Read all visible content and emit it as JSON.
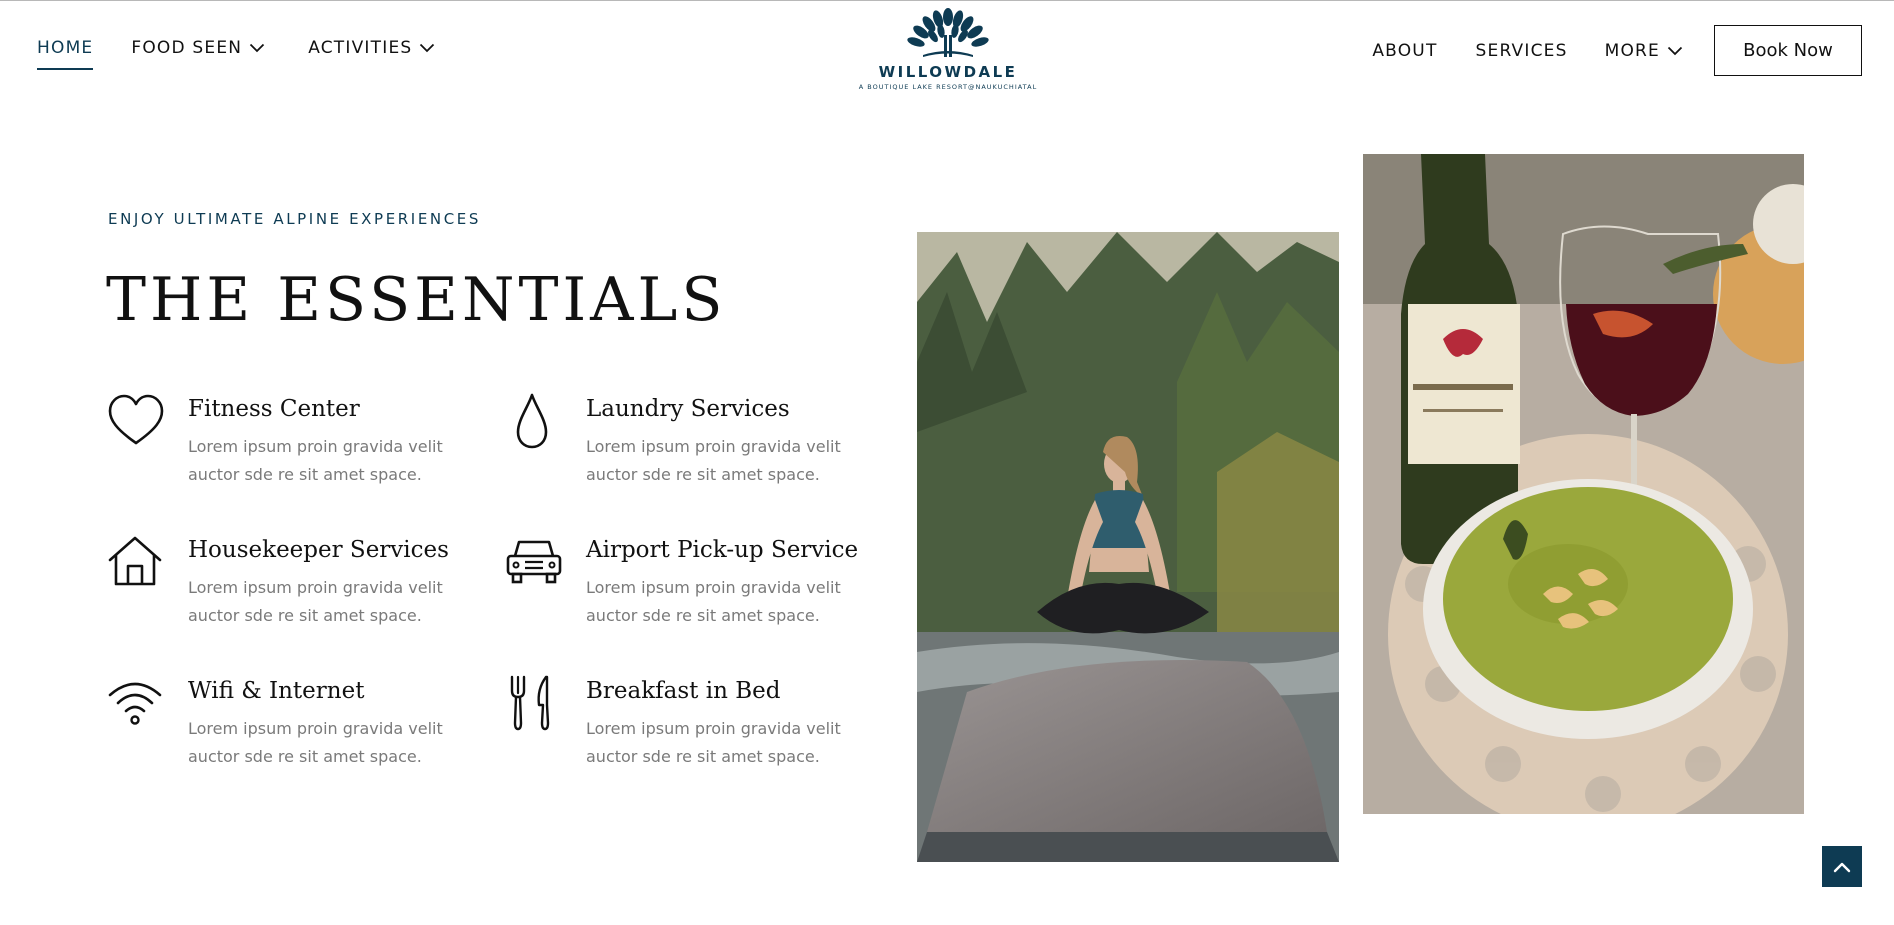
{
  "header": {
    "nav_left": [
      {
        "label": "HOME",
        "active": true,
        "has_dropdown": false
      },
      {
        "label": "FOOD SEEN",
        "active": false,
        "has_dropdown": true
      },
      {
        "label": "ACTIVITIES",
        "active": false,
        "has_dropdown": true
      }
    ],
    "nav_right": [
      {
        "label": "ABOUT",
        "has_dropdown": false
      },
      {
        "label": "SERVICES",
        "has_dropdown": false
      },
      {
        "label": "MORE",
        "has_dropdown": true
      }
    ],
    "cta_label": "Book Now",
    "logo": {
      "name": "WILLOWDALE",
      "tagline": "A BOUTIQUE LAKE RESORT@NAUKUCHIATAL"
    }
  },
  "essentials": {
    "eyebrow": "ENJOY ULTIMATE ALPINE EXPERIENCES",
    "heading": "THE ESSENTIALS",
    "features": [
      {
        "icon": "heart-icon",
        "title": "Fitness Center",
        "description": "Lorem ipsum proin gravida velit auctor sde re sit amet space."
      },
      {
        "icon": "water-drop-icon",
        "title": "Laundry Services",
        "description": "Lorem ipsum proin gravida velit auctor sde re sit amet space."
      },
      {
        "icon": "house-icon",
        "title": "Housekeeper Services",
        "description": "Lorem ipsum proin gravida velit auctor sde re sit amet space."
      },
      {
        "icon": "car-icon",
        "title": "Airport Pick-up Service",
        "description": "Lorem ipsum proin gravida velit auctor sde re sit amet space."
      },
      {
        "icon": "wifi-icon",
        "title": "Wifi & Internet",
        "description": "Lorem ipsum proin gravida velit auctor sde re sit amet space."
      },
      {
        "icon": "fork-knife-icon",
        "title": "Breakfast in Bed",
        "description": "Lorem ipsum proin gravida velit auctor sde re sit amet space."
      }
    ]
  },
  "images": [
    {
      "subject": "woman meditating on a rock by a river"
    },
    {
      "subject": "red wine bottle, wine glass and green soup bowl"
    }
  ],
  "scroll_top": {
    "icon": "chevron-up-icon"
  },
  "colors": {
    "brand": "#0e3b53",
    "text": "#111111",
    "muted": "#7a7a7a"
  }
}
